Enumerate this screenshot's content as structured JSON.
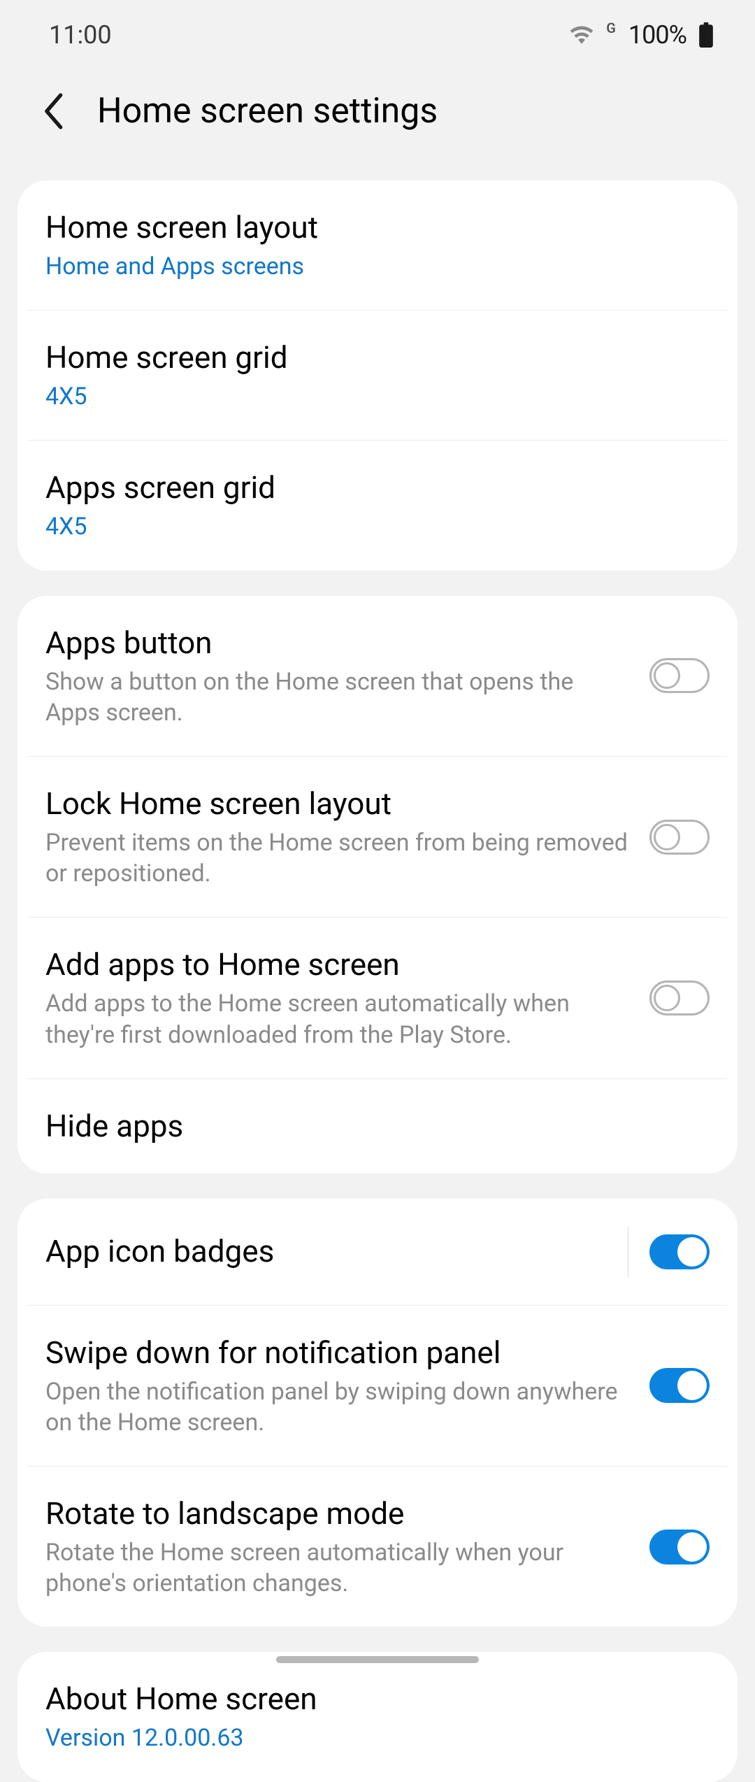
{
  "status": {
    "time": "11:00",
    "network_badge": "G",
    "battery": "100%"
  },
  "header": {
    "title": "Home screen settings"
  },
  "group1": {
    "layout": {
      "title": "Home screen layout",
      "sub": "Home and Apps screens"
    },
    "home_grid": {
      "title": "Home screen grid",
      "sub": "4X5"
    },
    "apps_grid": {
      "title": "Apps screen grid",
      "sub": "4X5"
    }
  },
  "group2": {
    "apps_button": {
      "title": "Apps button",
      "sub": "Show a button on the Home screen that opens the Apps screen."
    },
    "lock_layout": {
      "title": "Lock Home screen layout",
      "sub": "Prevent items on the Home screen from being removed or repositioned."
    },
    "add_apps": {
      "title": "Add apps to Home screen",
      "sub": "Add apps to the Home screen automatically when they're first downloaded from the Play Store."
    },
    "hide_apps": {
      "title": "Hide apps"
    }
  },
  "group3": {
    "badges": {
      "title": "App icon badges"
    },
    "swipe": {
      "title": "Swipe down for notification panel",
      "sub": "Open the notification panel by swiping down anywhere on the Home screen."
    },
    "rotate": {
      "title": "Rotate to landscape mode",
      "sub": "Rotate the Home screen automatically when your phone's orientation changes."
    }
  },
  "group4": {
    "about": {
      "title": "About Home screen",
      "sub": "Version 12.0.00.63"
    }
  }
}
